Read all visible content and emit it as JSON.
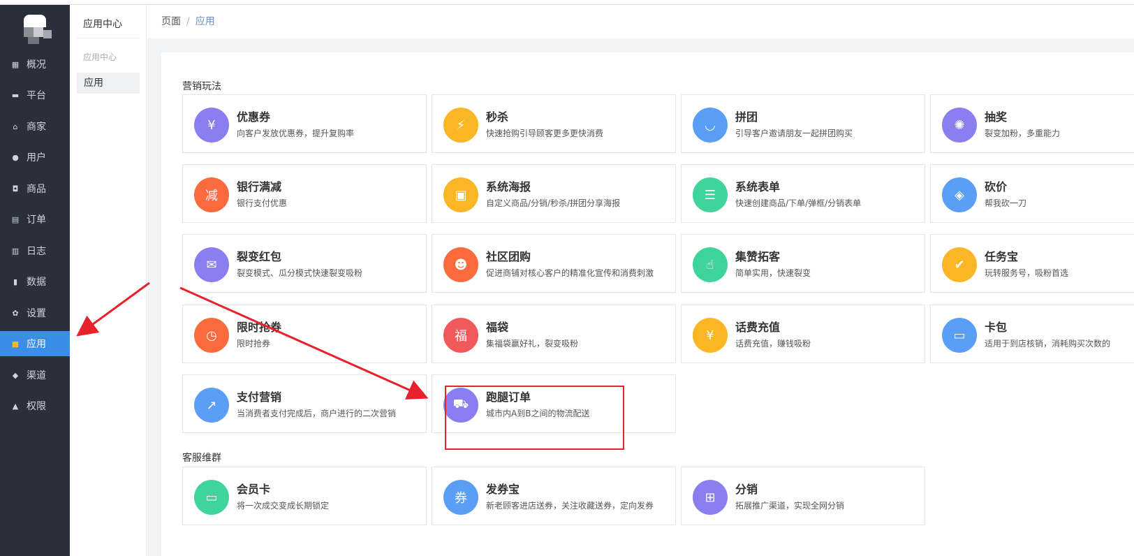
{
  "sidebar": {
    "items": [
      {
        "label": "概况",
        "icon": "overview-icon"
      },
      {
        "label": "平台",
        "icon": "monitor-icon"
      },
      {
        "label": "商家",
        "icon": "store-icon"
      },
      {
        "label": "用户",
        "icon": "user-icon"
      },
      {
        "label": "商品",
        "icon": "bag-icon"
      },
      {
        "label": "订单",
        "icon": "clipboard-icon"
      },
      {
        "label": "日志",
        "icon": "book-icon"
      },
      {
        "label": "数据",
        "icon": "bar-chart-icon"
      },
      {
        "label": "设置",
        "icon": "gear-icon"
      },
      {
        "label": "应用",
        "icon": "apps-grid-icon"
      },
      {
        "label": "渠道",
        "icon": "cube-icon"
      },
      {
        "label": "权限",
        "icon": "lock-icon"
      }
    ],
    "active_index": 9,
    "active_color": "#3a8ee6"
  },
  "subnav": {
    "title": "应用中心",
    "group": "应用中心",
    "item": "应用"
  },
  "breadcrumb": {
    "root": "页面",
    "sep": "/",
    "current": "应用"
  },
  "sections": [
    {
      "title": "营销玩法",
      "cards": [
        {
          "name": "优惠券",
          "desc": "向客户发放优惠券，提升复购率",
          "icon": "coupon-icon",
          "color": "#8b7ef0"
        },
        {
          "name": "秒杀",
          "desc": "快速抢购引导顾客更多更快消费",
          "icon": "alarm-clock-icon",
          "color": "#fbb626"
        },
        {
          "name": "拼团",
          "desc": "引导客户邀请朋友一起拼团购买",
          "icon": "shopping-bag-icon",
          "color": "#5b9ef5"
        },
        {
          "name": "抽奖",
          "desc": "裂变加粉，多重能力",
          "icon": "wheel-icon",
          "color": "#8b7ef0"
        },
        {
          "name": "银行满减",
          "desc": "银行支付优惠",
          "icon": "discount-icon",
          "color": "#fb6a3d"
        },
        {
          "name": "系统海报",
          "desc": "自定义商品/分销/秒杀/拼团分享海报",
          "icon": "image-icon",
          "color": "#fbb626"
        },
        {
          "name": "系统表单",
          "desc": "快速创建商品/下单/弹框/分销表单",
          "icon": "form-icon",
          "color": "#3fd59a"
        },
        {
          "name": "砍价",
          "desc": "帮我砍一刀",
          "icon": "tag-icon",
          "color": "#5b9ef5"
        },
        {
          "name": "裂变红包",
          "desc": "裂变模式、瓜分模式快速裂变吸粉",
          "icon": "red-packet-icon",
          "color": "#8b7ef0"
        },
        {
          "name": "社区团购",
          "desc": "促进商铺对核心客户的精准化宣传和消费刺激",
          "icon": "group-users-icon",
          "color": "#fb6a3d"
        },
        {
          "name": "集赞拓客",
          "desc": "简单实用，快速裂变",
          "icon": "thumbs-up-icon",
          "color": "#3fd59a"
        },
        {
          "name": "任务宝",
          "desc": "玩转服务号，吸粉首选",
          "icon": "task-clipboard-icon",
          "color": "#fbb626"
        },
        {
          "name": "限时抢券",
          "desc": "限时抢券",
          "icon": "stopwatch-icon",
          "color": "#fb6a3d"
        },
        {
          "name": "福袋",
          "desc": "集福袋赢好礼，裂变吸粉",
          "icon": "lucky-bag-icon",
          "color": "#f15a5a"
        },
        {
          "name": "话费充值",
          "desc": "话费充值，赚钱吸粉",
          "icon": "phone-recharge-icon",
          "color": "#fbb626"
        },
        {
          "name": "卡包",
          "desc": "适用于到店核销，消耗购买次数的",
          "icon": "wallet-icon",
          "color": "#5b9ef5"
        },
        {
          "name": "支付营销",
          "desc": "当消费者支付完成后，商户进行的二次营销",
          "icon": "trend-chart-icon",
          "color": "#5b9ef5"
        },
        {
          "name": "跑腿订单",
          "desc": "城市内A到B之间的物流配送",
          "icon": "delivery-scooter-icon",
          "color": "#8b7ef0"
        }
      ]
    },
    {
      "title": "客服维群",
      "cards": [
        {
          "name": "会员卡",
          "desc": "将一次成交变成长期锁定",
          "icon": "member-card-icon",
          "color": "#3fd59a"
        },
        {
          "name": "发券宝",
          "desc": "新老顾客进店送券，关注收藏送券，定向发券",
          "icon": "ticket-icon",
          "color": "#5b9ef5"
        },
        {
          "name": "分销",
          "desc": "拓展推广渠道，实现全网分销",
          "icon": "org-chart-icon",
          "color": "#8b7ef0"
        }
      ]
    }
  ]
}
